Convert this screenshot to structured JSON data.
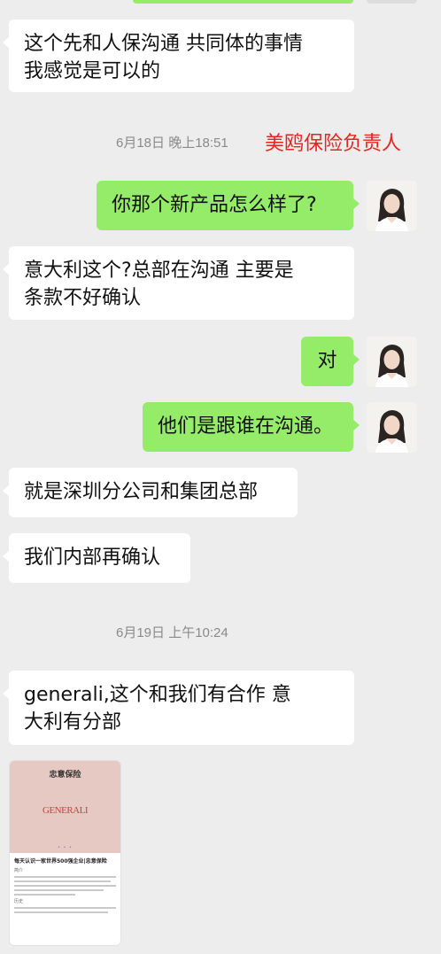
{
  "messages": {
    "m1": "这个先和人保沟通 共同体的事情\n我感觉是可以的",
    "ts1": "6月18日 晚上18:51",
    "annotation": "美鸥保险负责人",
    "m2": "你那个新产品怎么样了?",
    "m3": "意大利这个?总部在沟通  主要是\n条款不好确认",
    "m4": "对",
    "m5": "他们是跟谁在沟通。",
    "m6": "就是深圳分公司和集团总部",
    "m7": "我们内部再确认",
    "ts2": "6月19日 上午10:24",
    "m8": "generali,这个和我们有合作  意\n大利有分部"
  },
  "image_card": {
    "brand_cn": "忠意保险",
    "logo": "GENERALI",
    "headline": "每天认识一家世界500强企业|忠意保险",
    "section1": "简介",
    "section2": "历史"
  },
  "colors": {
    "sent_bubble": "#95ec69",
    "received_bubble": "#ffffff",
    "background": "#ededed",
    "annotation": "#e8241e",
    "timestamp": "#8a8a8a"
  },
  "icons": {
    "avatar": "user-avatar-woman"
  }
}
